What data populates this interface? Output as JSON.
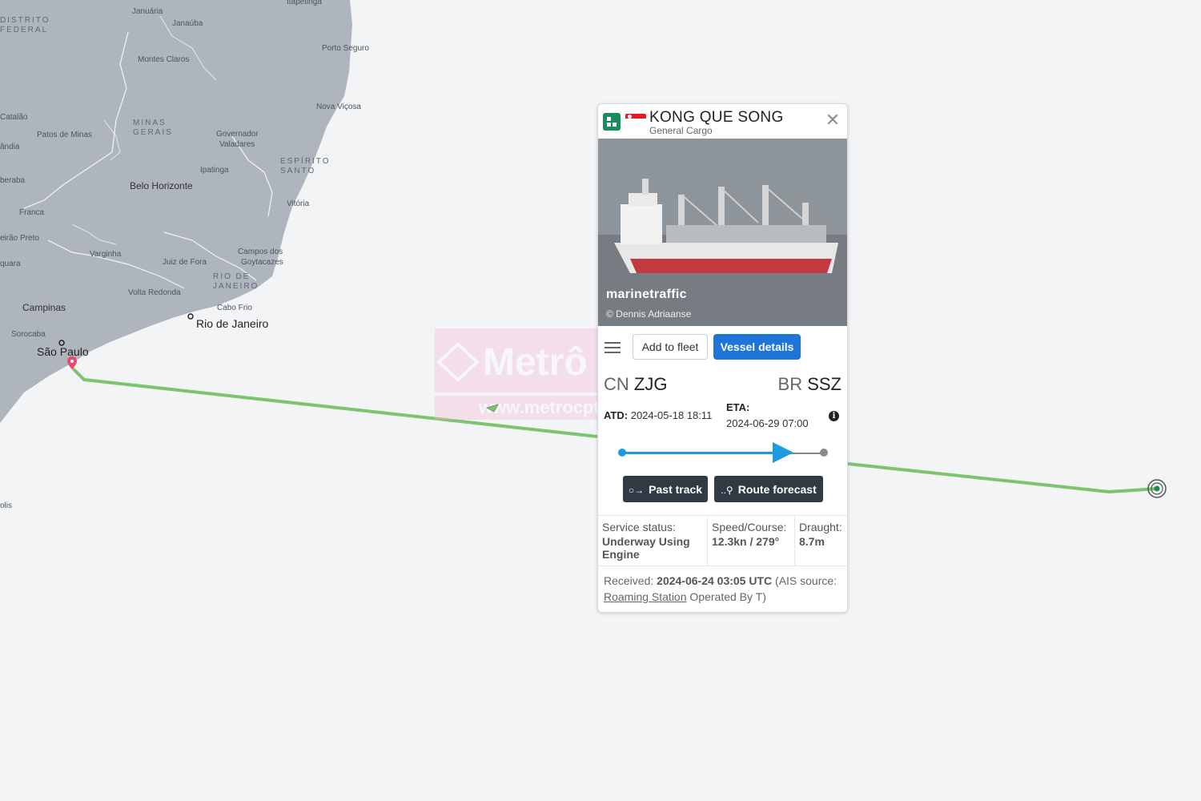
{
  "map": {
    "cities": [
      {
        "name": "Januária"
      },
      {
        "name": "Janaúba"
      },
      {
        "name": "Montes Claros"
      },
      {
        "name": "Porto Seguro"
      },
      {
        "name": "Nova Viçosa"
      },
      {
        "name": "Catalão"
      },
      {
        "name": "Patos de Minas"
      },
      {
        "name": "Governador Valadares"
      },
      {
        "name": "Ipatinga"
      },
      {
        "name": "Belo Horizonte"
      },
      {
        "name": "Vitória"
      },
      {
        "name": "Franca"
      },
      {
        "name": "Varginha"
      },
      {
        "name": "Juiz de Fora"
      },
      {
        "name": "Campos dos Goytacazes"
      },
      {
        "name": "Volta Redonda"
      },
      {
        "name": "Campinas"
      },
      {
        "name": "Sorocaba"
      },
      {
        "name": "Cabo Frio"
      },
      {
        "name": "Rio de Janeiro"
      },
      {
        "name": "São Paulo"
      }
    ],
    "states": [
      "DISTRITO FEDERAL",
      "MINAS GERAIS",
      "ESPÍRITO SANTO",
      "RIO DE JANEIRO"
    ],
    "edge_labels": [
      "Itapetinga",
      "ândia",
      "beraba",
      "eirão Preto",
      "quara",
      "olis"
    ],
    "colors": {
      "land": "#aeb5bd",
      "sea": "#f3f4f6",
      "track": "#7dc470",
      "pin": "#e84a6f"
    }
  },
  "watermark": {
    "title": "Metrô CPTM",
    "url": "www.metrocptm.com.br"
  },
  "vessel": {
    "name": "KONG QUE SONG",
    "type": "General Cargo",
    "flag_icon": "singapore-flag",
    "photo_brand": "marinetraffic",
    "photo_credit": "© Dennis Adriaanse"
  },
  "actions": {
    "menu_icon": "hamburger-menu-icon",
    "add_to_fleet": "Add to fleet",
    "vessel_details": "Vessel details"
  },
  "voyage": {
    "from_country": "CN",
    "from_port": "ZJG",
    "to_country": "BR",
    "to_port": "SSZ",
    "atd_label": "ATD:",
    "atd_value": "2024-05-18 18:11",
    "eta_label": "ETA:",
    "eta_value": "2024-06-29 07:00",
    "progress": 0.84
  },
  "track_buttons": {
    "past_track": "Past track",
    "route_forecast": "Route forecast"
  },
  "stats": {
    "service_status_label": "Service status:",
    "service_status_value": "Underway Using Engine",
    "speed_course_label": "Speed/Course:",
    "speed_course_value": "12.3kn / 279°",
    "draught_label": "Draught:",
    "draught_value": "8.7m"
  },
  "received": {
    "label": "Received:",
    "value": "2024-06-24 03:05 UTC",
    "source_prefix": "(AIS source:",
    "source_link": "Roaming Station",
    "source_suffix": "Operated By T)"
  }
}
